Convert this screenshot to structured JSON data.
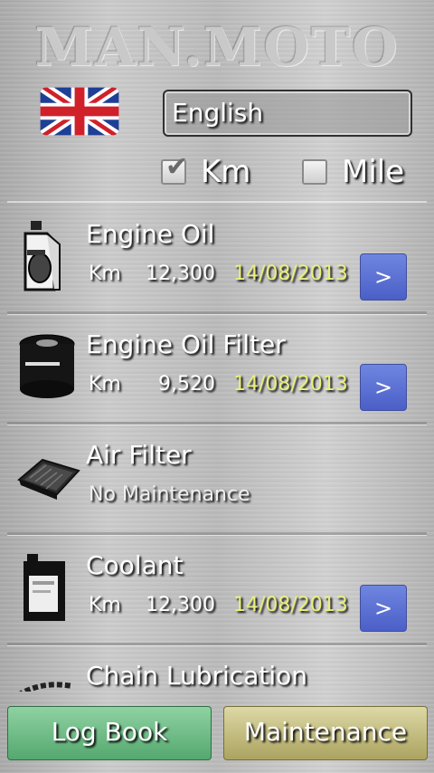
{
  "app": {
    "logo_text": "MAN.MOTO"
  },
  "language": {
    "selected": "English",
    "flag_icon": "uk-flag-icon"
  },
  "units": [
    {
      "label": "Km",
      "checked": true
    },
    {
      "label": "Mile",
      "checked": false
    }
  ],
  "items": [
    {
      "title": "Engine Oil",
      "unit": "Km",
      "km": "12,300",
      "date": "14/08/2013",
      "button": ">",
      "icon": "oil-bottle-icon"
    },
    {
      "title": "Engine Oil Filter",
      "unit": "Km",
      "km": "9,520",
      "date": "14/08/2013",
      "button": ">",
      "icon": "oil-filter-icon"
    },
    {
      "title": "Air Filter",
      "status": "No Maintenance",
      "icon": "air-filter-icon"
    },
    {
      "title": "Coolant",
      "unit": "Km",
      "km": "12,300",
      "date": "14/08/2013",
      "button": ">",
      "icon": "coolant-can-icon"
    },
    {
      "title": "Chain Lubrication",
      "icon": "chain-icon"
    }
  ],
  "footer": {
    "logbook_label": "Log Book",
    "maintenance_label": "Maintenance"
  },
  "colors": {
    "date": "#e9f07d",
    "go_button": "#5a6fd3",
    "logbook": "#6fbe88",
    "maintenance": "#c4bd80"
  }
}
